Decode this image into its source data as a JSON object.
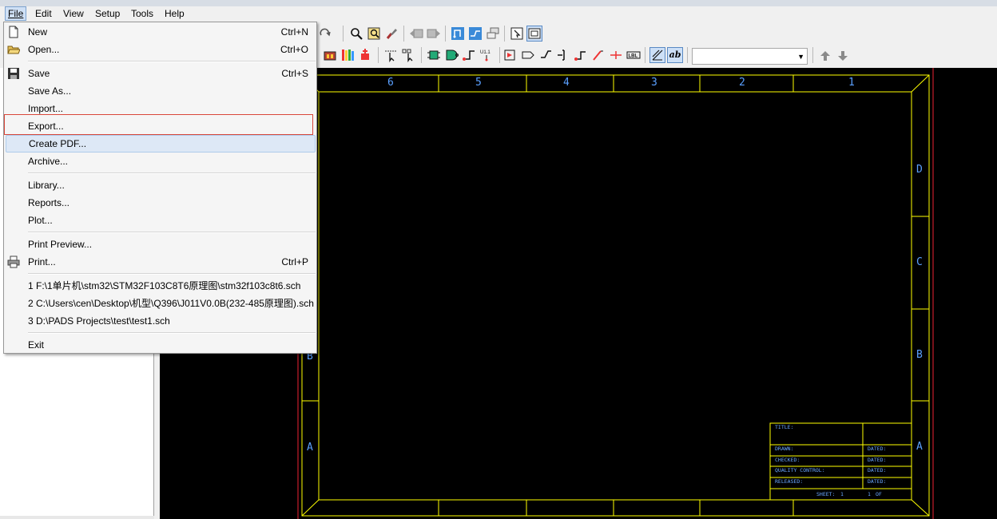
{
  "menubar": {
    "items": [
      {
        "label": "File",
        "underline": "F"
      },
      {
        "label": "Edit",
        "underline": "E"
      },
      {
        "label": "View",
        "underline": "V"
      },
      {
        "label": "Setup",
        "underline": "S"
      },
      {
        "label": "Tools",
        "underline": "T"
      },
      {
        "label": "Help",
        "underline": "H"
      }
    ]
  },
  "file_menu": {
    "new": {
      "label": "New",
      "shortcut": "Ctrl+N"
    },
    "open": {
      "label": "Open...",
      "shortcut": "Ctrl+O"
    },
    "save": {
      "label": "Save",
      "shortcut": "Ctrl+S"
    },
    "save_as": {
      "label": "Save As..."
    },
    "import": {
      "label": "Import..."
    },
    "export": {
      "label": "Export..."
    },
    "create_pdf": {
      "label": "Create PDF..."
    },
    "archive": {
      "label": "Archive..."
    },
    "library": {
      "label": "Library..."
    },
    "reports": {
      "label": "Reports..."
    },
    "plot": {
      "label": "Plot..."
    },
    "print_preview": {
      "label": "Print Preview..."
    },
    "print": {
      "label": "Print...",
      "shortcut": "Ctrl+P"
    },
    "recent": [
      "1 F:\\1单片机\\stm32\\STM32F103C8T6原理图\\stm32f103c8t6.sch",
      "2 C:\\Users\\cen\\Desktop\\机型\\Q396\\J011V0.0B(232-485原理图).sch",
      "3 D:\\PADS Projects\\test\\test1.sch"
    ],
    "exit": {
      "label": "Exit"
    }
  },
  "toolbar": {
    "combo_value": "",
    "icons_row1": [
      "zoom-icon",
      "zoom-window-icon",
      "paint-brush-icon",
      "back-icon",
      "forward-icon",
      "bus-icon",
      "wire-icon",
      "hierarchy-icon",
      "select-filter-icon",
      "zoom-fit-icon"
    ],
    "icons_row2": [
      "part-editor-icon",
      "library-icon",
      "add-part-icon",
      "select-icon",
      "select-alt-icon",
      "chip-icon",
      "gate-icon",
      "pin-icon",
      "u11-label-icon",
      "off-page-icon",
      "tag-icon",
      "bus-entry-icon",
      "connector-icon",
      "power-icon",
      "ground-icon",
      "label-icon",
      "net-name-icon",
      "text-ab-icon"
    ],
    "u11_label": "U1.1",
    "lbl_label": "LBL",
    "ab_label": "ab"
  },
  "sheet": {
    "column_labels": [
      "6",
      "5",
      "4",
      "3",
      "2",
      "1"
    ],
    "right_row_labels": [
      "D",
      "C",
      "B",
      "A"
    ],
    "left_row_labels": [
      "B",
      "A"
    ],
    "title_block": {
      "title": "TITLE:",
      "drawn": "DRAWN:",
      "checked": "CHECKED:",
      "quality_control": "QUALITY CONTROL:",
      "released": "RELEASED:",
      "dated": "DATED:",
      "sheet": "SHEET:",
      "sheet_num": "1",
      "sheet_total": "1",
      "of": "OF"
    },
    "colors": {
      "border": "#ffff00",
      "labels": "#3c78ff",
      "canvas": "#000000",
      "sheet_edge": "#ff3030"
    }
  }
}
